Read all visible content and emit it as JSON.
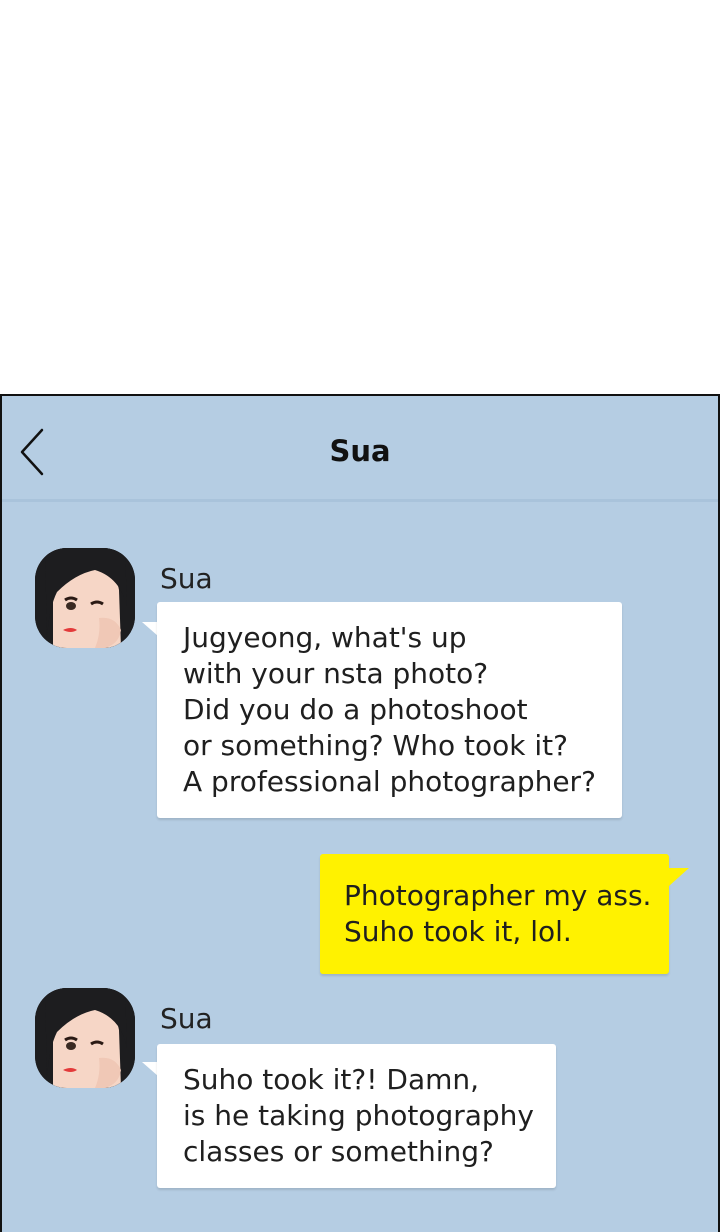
{
  "chat": {
    "title": "Sua",
    "back_icon": "chevron-left-icon",
    "colors": {
      "background": "#b5cde3",
      "incoming_bubble": "#ffffff",
      "outgoing_bubble": "#fff200"
    }
  },
  "messages": [
    {
      "direction": "incoming",
      "sender": "Sua",
      "lines": [
        "Jugyeong, what's up",
        "with your nsta photo?",
        "Did you do a photoshoot",
        "or something? Who took it?",
        "A professional photographer?"
      ]
    },
    {
      "direction": "outgoing",
      "lines": [
        "Photographer my ass.",
        "Suho took it, lol."
      ]
    },
    {
      "direction": "incoming",
      "sender": "Sua",
      "lines": [
        "Suho took it?! Damn,",
        "is he taking photography",
        "classes or something?"
      ]
    }
  ]
}
